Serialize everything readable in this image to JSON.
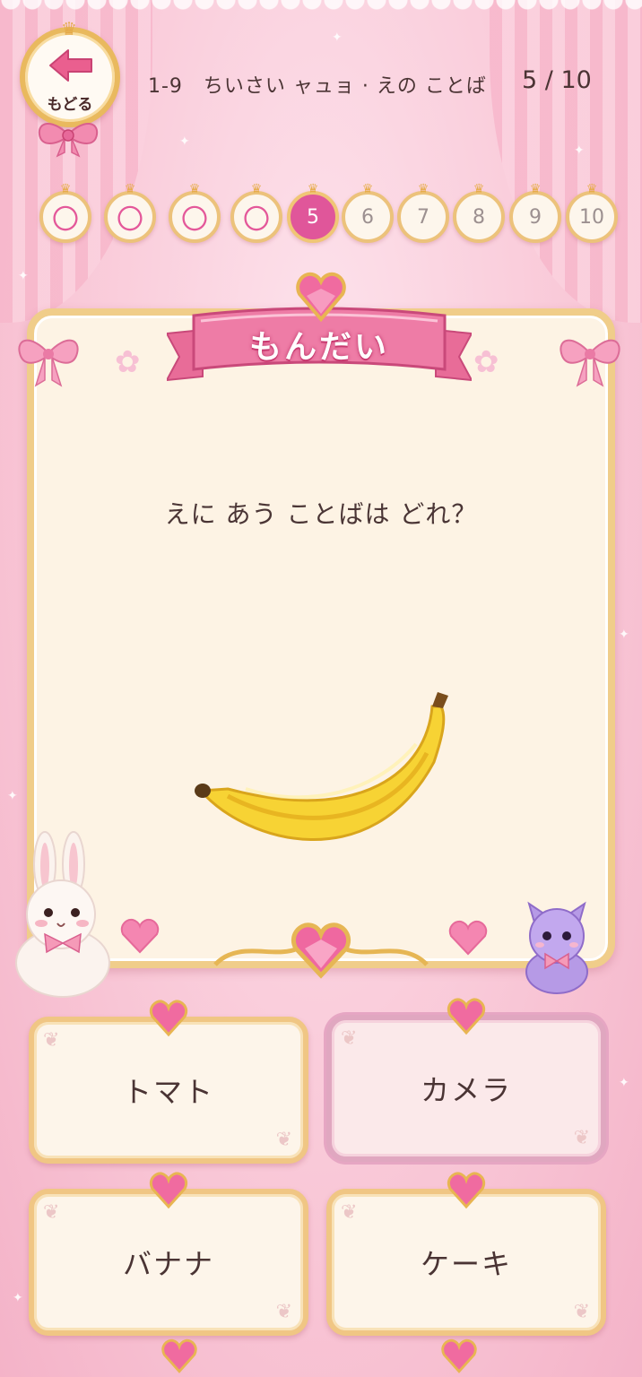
{
  "header": {
    "back_label": "もどる",
    "stage_title": "1-9　ちいさい ャュョ · えの ことば",
    "progress": "5 / 10"
  },
  "steps": [
    {
      "label": "〇",
      "state": "done"
    },
    {
      "label": "〇",
      "state": "done"
    },
    {
      "label": "〇",
      "state": "done"
    },
    {
      "label": "〇",
      "state": "done"
    },
    {
      "label": "5",
      "state": "current"
    },
    {
      "label": "6",
      "state": "upcoming"
    },
    {
      "label": "7",
      "state": "upcoming"
    },
    {
      "label": "8",
      "state": "upcoming"
    },
    {
      "label": "9",
      "state": "upcoming"
    },
    {
      "label": "10",
      "state": "upcoming"
    }
  ],
  "card": {
    "banner": "もんだい",
    "question": "えに あう ことばは どれ？",
    "picture": "banana-illustration"
  },
  "answers": [
    {
      "label": "トマト",
      "selected": false
    },
    {
      "label": "カメラ",
      "selected": true
    },
    {
      "label": "バナナ",
      "selected": false
    },
    {
      "label": "ケーキ",
      "selected": false
    }
  ],
  "colors": {
    "accent_pink": "#e0569a",
    "gold_frame": "#f0cd8a",
    "card_bg": "#fdf3e4"
  }
}
